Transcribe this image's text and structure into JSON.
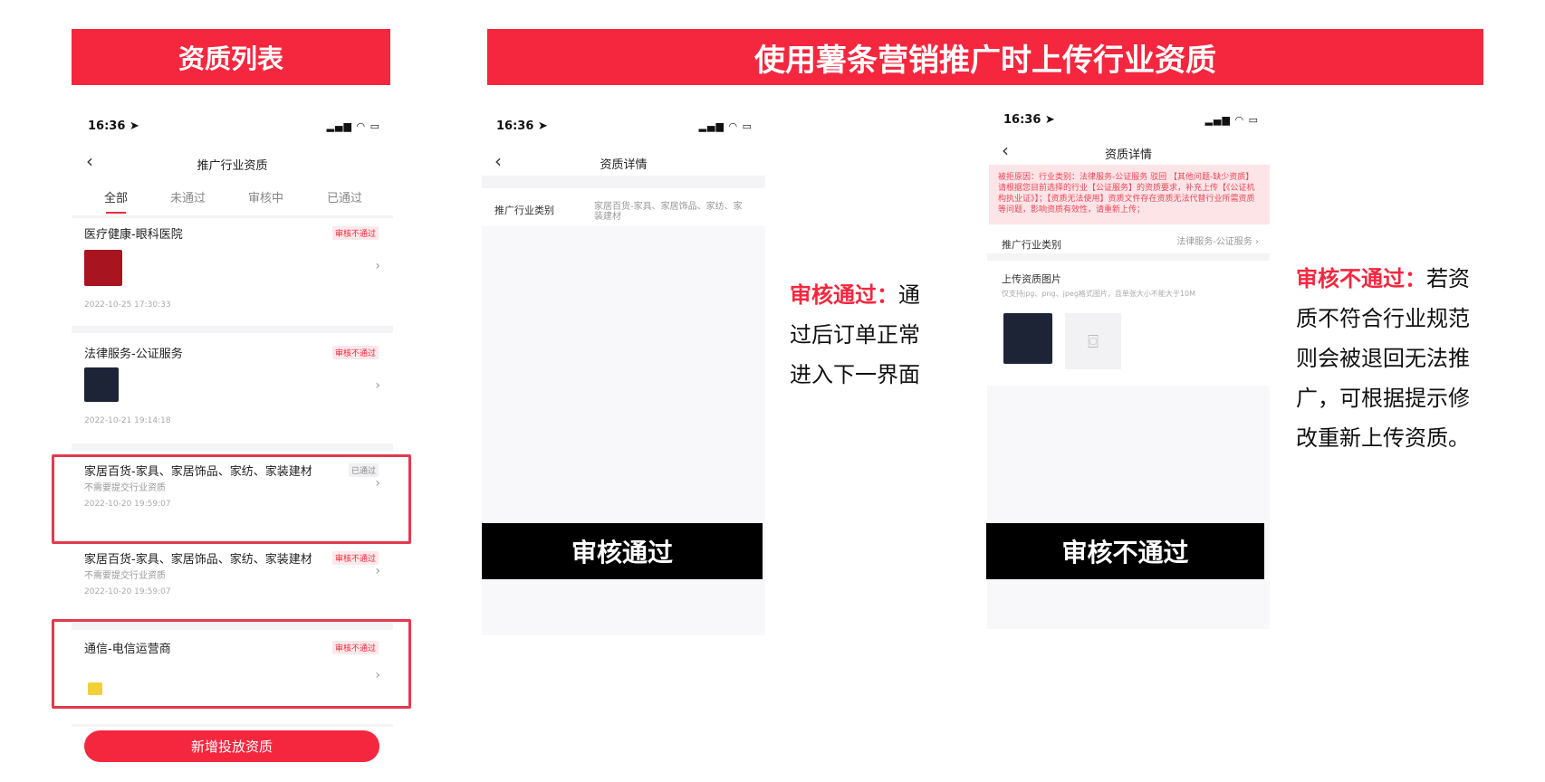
{
  "banners": {
    "left": "资质列表",
    "right": "使用薯条营销推广时上传行业资质"
  },
  "phone1": {
    "time": "16:36",
    "nav_title": "推广行业资质",
    "tabs": [
      "全部",
      "未通过",
      "审核中",
      "已通过"
    ],
    "items": [
      {
        "title": "医疗健康-眼科医院",
        "badge": "审核不通过",
        "date": "2022-10-25 17:30:33"
      },
      {
        "title": "法律服务-公证服务",
        "badge": "审核不通过",
        "date": "2022-10-21 19:14:18"
      },
      {
        "title": "家居百货-家具、家居饰品、家纺、家装建材",
        "badge": "已通过",
        "sub": "不需要提交行业资质",
        "date": "2022-10-20 19:59:07"
      },
      {
        "title": "家居百货-家具、家居饰品、家纺、家装建材",
        "badge": "审核不通过",
        "sub": "不需要提交行业资质",
        "date": "2022-10-20 19:59:07"
      },
      {
        "title": "通信-电信运营商",
        "badge": "审核不通过"
      }
    ],
    "button": "新增投放资质"
  },
  "phone2": {
    "time": "16:36",
    "nav_title": "资质详情",
    "field_label": "推广行业类别",
    "field_value_line1": "家居百货-家具、家居饰品、家纺、家",
    "field_value_line2": "装建材",
    "overlay": "审核通过"
  },
  "caption_pass": {
    "highlight": "审核通过：",
    "line1_rest": "通",
    "line2": "过后订单正常",
    "line3": "进入下一界面"
  },
  "phone3": {
    "time": "16:36",
    "nav_title": "资质详情",
    "reject_reason": "被拒原因：行业类别：法律服务-公证服务 驳回 【其他问题-缺少资质】请根据您目前选择的行业【公证服务】的资质要求，补充上传【《公证机构执业证》】；【资质无法使用】资质文件存在资质无法代替行业所需资质等问题，影响资质有效性，请重新上传；",
    "field_label": "推广行业类别",
    "field_value": "法律服务-公证服务",
    "upload_label": "上传资质图片",
    "upload_hint": "仅支持jpg、png、jpeg格式图片，且单张大小不能大于10M",
    "overlay": "审核不通过"
  },
  "caption_fail": {
    "highlight": "审核不通过：",
    "line1_rest": "若资",
    "line2": "质不符合行业规范",
    "line3": "则会被退回无法推",
    "line4": "广，可根据提示修",
    "line5": "改重新上传资质。"
  },
  "colors": {
    "accent": "#f5273f",
    "highlight_border": "#e23a4e"
  },
  "icons": [
    "location-arrow-icon",
    "signal-icon",
    "wifi-icon",
    "battery-icon",
    "back-chevron-icon",
    "chevron-right-icon",
    "camera-icon"
  ]
}
